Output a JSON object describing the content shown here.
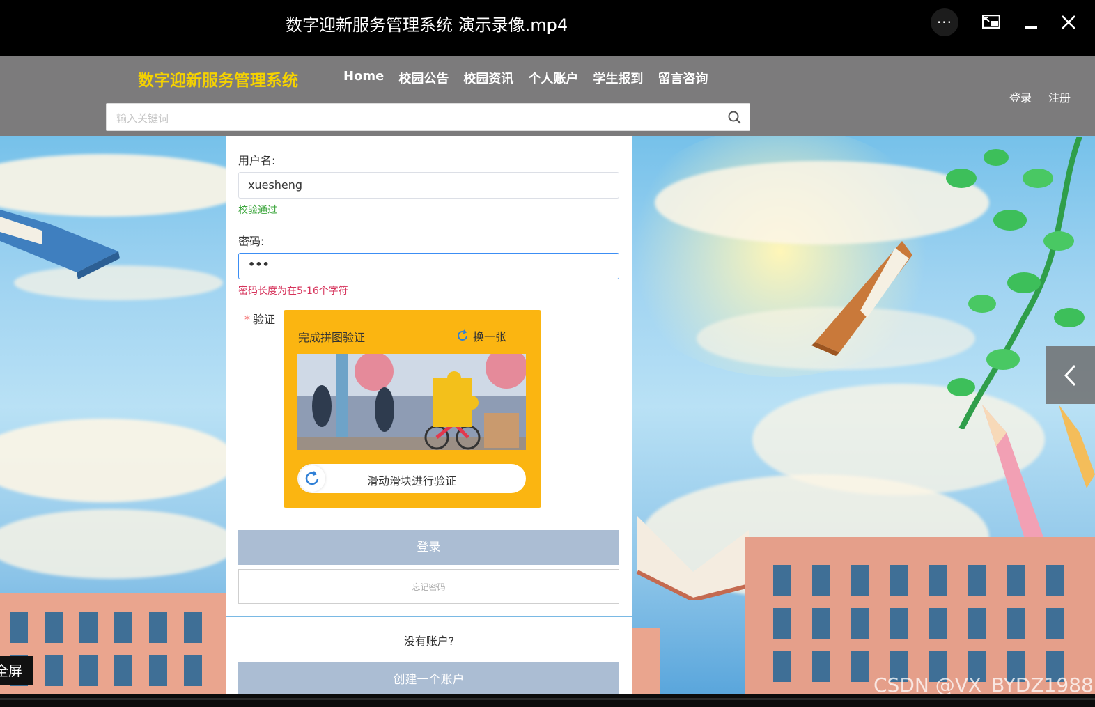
{
  "player": {
    "title": "数字迎新服务管理系统 演示录像.mp4",
    "more_label": "···"
  },
  "site": {
    "logo": "数字迎新服务管理系统",
    "nav": [
      "Home",
      "校园公告",
      "校园资讯",
      "个人账户",
      "学生报到",
      "留言咨询"
    ],
    "login": "登录",
    "register": "注册",
    "search_placeholder": "输入关键词"
  },
  "form": {
    "username_label": "用户名:",
    "username_value": "xuesheng",
    "username_msg": "校验通过",
    "password_label": "密码:",
    "password_value": "•••",
    "password_msg": "密码长度为在5-16个字符",
    "captcha_label": "验证",
    "captcha_required": "*",
    "captcha_title": "完成拼图验证",
    "captcha_refresh": "换一张",
    "captcha_slider": "滑动滑块进行验证",
    "login_button": "登录",
    "forgot_button": "忘记密码",
    "no_account": "没有账户?",
    "create_button": "创建一个账户"
  },
  "overlay": {
    "fullscreen_tip": "全屏",
    "watermark": "CSDN @VX_BYDZ1988"
  },
  "colors": {
    "logo": "#f5d200",
    "header_bg": "#7c7b7c",
    "captcha_bg": "#fbb511",
    "ok": "#3aa53a",
    "error": "#d6335b",
    "button": "#abbdd3"
  }
}
